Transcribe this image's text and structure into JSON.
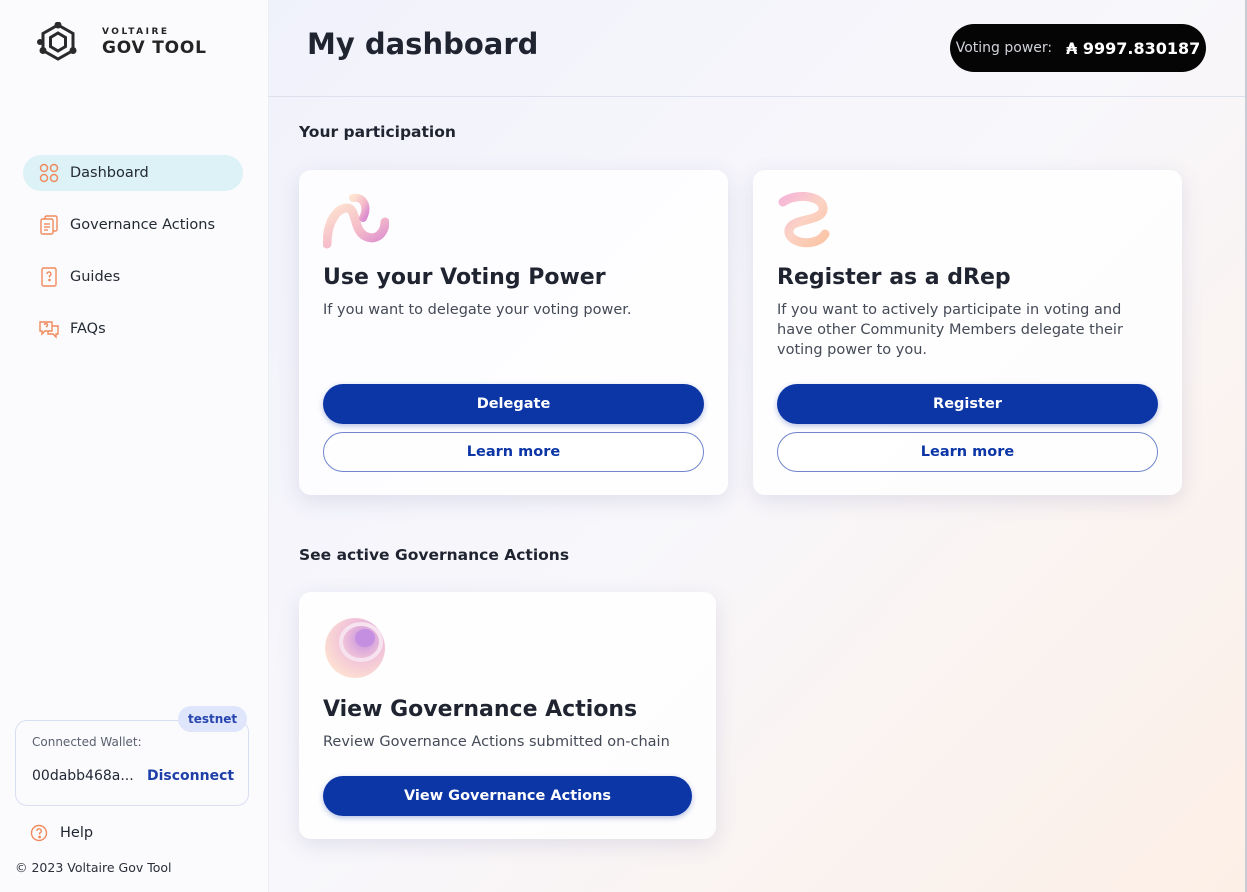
{
  "brand": {
    "small": "VOLTAIRE",
    "big": "GOV TOOL"
  },
  "nav": [
    {
      "label": "Dashboard",
      "icon": "dashboard-grid-icon",
      "active": true
    },
    {
      "label": "Governance Actions",
      "icon": "document-stack-icon",
      "active": false
    },
    {
      "label": "Guides",
      "icon": "guide-book-icon",
      "active": false
    },
    {
      "label": "FAQs",
      "icon": "faq-bubble-icon",
      "active": false
    }
  ],
  "wallet": {
    "network_badge": "testnet",
    "label": "Connected Wallet:",
    "address": "00dabb468a...",
    "disconnect": "Disconnect"
  },
  "help": {
    "label": "Help"
  },
  "footer": {
    "copyright": "© 2023 Voltaire Gov Tool"
  },
  "header": {
    "title": "My dashboard",
    "voting_power_label": "Voting power:",
    "voting_power_value": "₳ 9997.830187"
  },
  "sections": {
    "participation": "Your participation",
    "active": "See active Governance Actions"
  },
  "cards": {
    "delegate": {
      "title": "Use your Voting Power",
      "desc": "If you want to delegate your voting power.",
      "primary": "Delegate",
      "secondary": "Learn more"
    },
    "register": {
      "title": "Register as a dRep",
      "desc": "If you want to actively participate in voting and have other Community Members delegate their voting power to you.",
      "primary": "Register",
      "secondary": "Learn more"
    },
    "view": {
      "title": "View Governance Actions",
      "desc": "Review Governance Actions submitted on-chain",
      "primary": "View Governance Actions"
    }
  },
  "colors": {
    "primary": "#0c35a6",
    "nav_active_bg": "#dcf2f6",
    "accent_orange": "#f08a5d",
    "voting_pill_bg": "#050505"
  }
}
